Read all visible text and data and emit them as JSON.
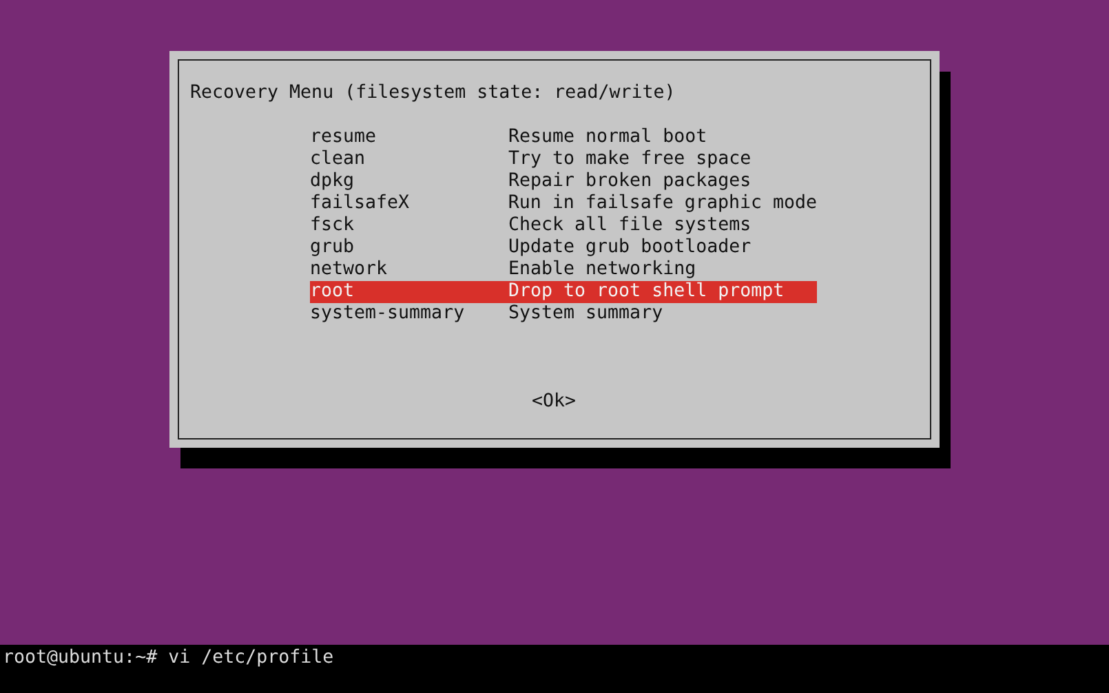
{
  "dialog": {
    "title": "Recovery Menu (filesystem state: read/write)",
    "items": [
      {
        "tag": "resume",
        "description": "Resume normal boot",
        "selected": false
      },
      {
        "tag": "clean",
        "description": "Try to make free space",
        "selected": false
      },
      {
        "tag": "dpkg",
        "description": "Repair broken packages",
        "selected": false
      },
      {
        "tag": "failsafeX",
        "description": "Run in failsafe graphic mode",
        "selected": false
      },
      {
        "tag": "fsck",
        "description": "Check all file systems",
        "selected": false
      },
      {
        "tag": "grub",
        "description": "Update grub bootloader",
        "selected": false
      },
      {
        "tag": "network",
        "description": "Enable networking",
        "selected": false
      },
      {
        "tag": "root",
        "description": "Drop to root shell prompt",
        "selected": true
      },
      {
        "tag": "system-summary",
        "description": "System summary",
        "selected": false
      }
    ],
    "button": "<Ok>"
  },
  "terminal": {
    "command_line": "root@ubuntu:~# vi /etc/profile"
  }
}
